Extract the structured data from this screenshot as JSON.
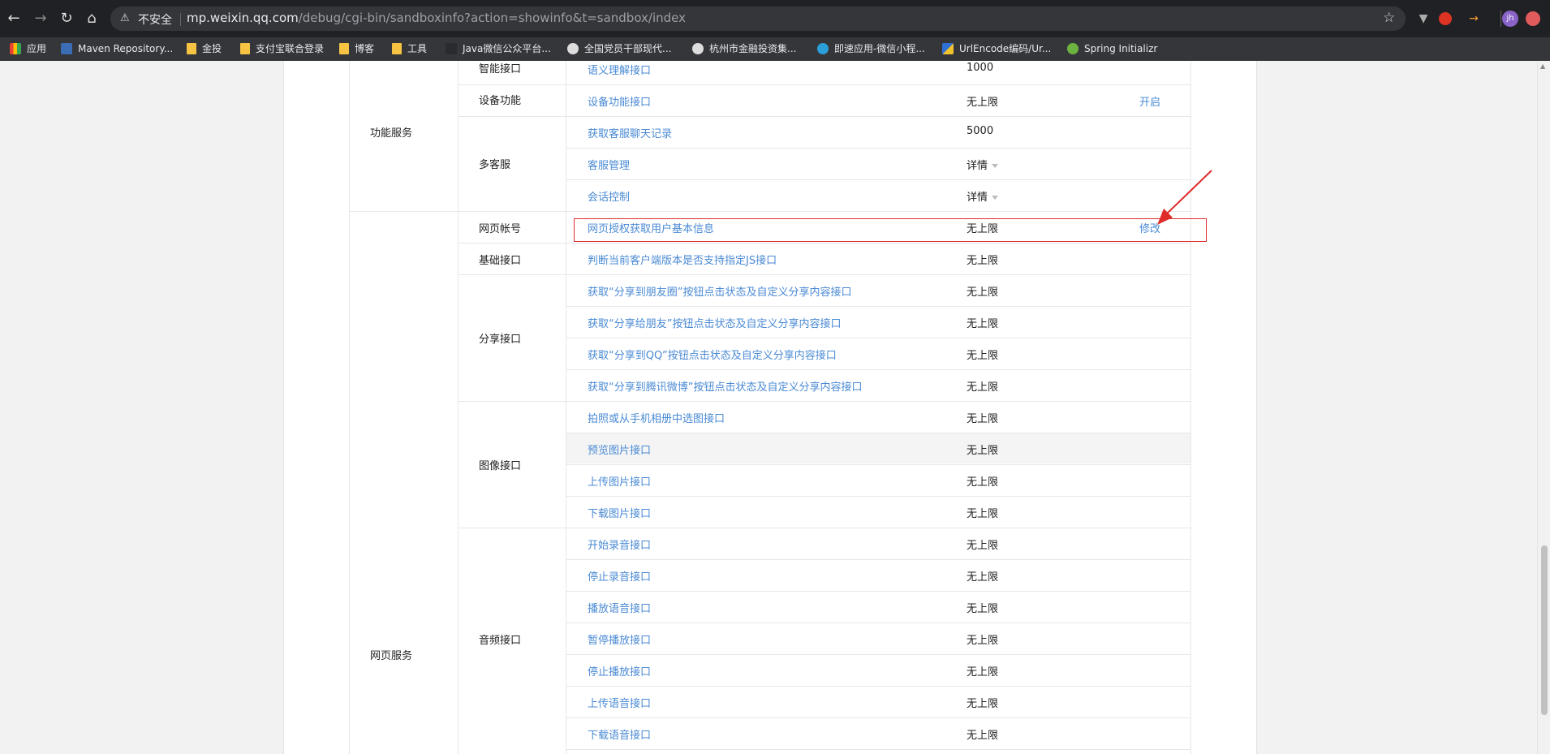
{
  "browser": {
    "insecure_label": "不安全",
    "url_host": "mp.weixin.qq.com",
    "url_path": "/debug/cgi-bin/sandboxinfo?action=showinfo&t=sandbox/index",
    "profile_initials": "jh",
    "bookmarks": [
      {
        "label": "应用",
        "icon": "apps-grid-icon"
      },
      {
        "label": "Maven Repository...",
        "icon": "maven-icon"
      },
      {
        "label": "金投",
        "icon": "folder-icon"
      },
      {
        "label": "支付宝联合登录",
        "icon": "folder-icon"
      },
      {
        "label": "博客",
        "icon": "folder-icon"
      },
      {
        "label": "工具",
        "icon": "folder-icon"
      },
      {
        "label": "Java微信公众平台...",
        "icon": "blank-page-icon"
      },
      {
        "label": "全国党员干部现代...",
        "icon": "globe-icon"
      },
      {
        "label": "杭州市金融投资集...",
        "icon": "globe-icon"
      },
      {
        "label": "即速应用-微信小程...",
        "icon": "app-logo-icon"
      },
      {
        "label": "UrlEncode编码/Ur...",
        "icon": "urlencode-icon"
      },
      {
        "label": "Spring Initializr",
        "icon": "spring-leaf-icon"
      }
    ]
  },
  "table": {
    "sections": [
      {
        "name": "功能服务"
      },
      {
        "name": "网页服务"
      }
    ],
    "groups": [
      {
        "name": "智能接口"
      },
      {
        "name": "设备功能"
      },
      {
        "name": "多客服"
      },
      {
        "name": "网页帐号"
      },
      {
        "name": "基础接口"
      },
      {
        "name": "分享接口"
      },
      {
        "name": "图像接口"
      },
      {
        "name": "音频接口"
      }
    ],
    "rows": [
      {
        "api": "语义理解接口",
        "limit": "1000",
        "action": ""
      },
      {
        "api": "设备功能接口",
        "limit": "无上限",
        "action": "开启"
      },
      {
        "api": "获取客服聊天记录",
        "limit": "5000",
        "action": ""
      },
      {
        "api": "客服管理",
        "limit": "详情",
        "action": ""
      },
      {
        "api": "会话控制",
        "limit": "详情",
        "action": ""
      },
      {
        "api": "网页授权获取用户基本信息",
        "limit": "无上限",
        "action": "修改"
      },
      {
        "api": "判断当前客户端版本是否支持指定JS接口",
        "limit": "无上限",
        "action": ""
      },
      {
        "api": "获取“分享到朋友圈”按钮点击状态及自定义分享内容接口",
        "limit": "无上限",
        "action": ""
      },
      {
        "api": "获取“分享给朋友”按钮点击状态及自定义分享内容接口",
        "limit": "无上限",
        "action": ""
      },
      {
        "api": "获取“分享到QQ”按钮点击状态及自定义分享内容接口",
        "limit": "无上限",
        "action": ""
      },
      {
        "api": "获取“分享到腾讯微博”按钮点击状态及自定义分享内容接口",
        "limit": "无上限",
        "action": ""
      },
      {
        "api": "拍照或从手机相册中选图接口",
        "limit": "无上限",
        "action": ""
      },
      {
        "api": "预览图片接口",
        "limit": "无上限",
        "action": ""
      },
      {
        "api": "上传图片接口",
        "limit": "无上限",
        "action": ""
      },
      {
        "api": "下载图片接口",
        "limit": "无上限",
        "action": ""
      },
      {
        "api": "开始录音接口",
        "limit": "无上限",
        "action": ""
      },
      {
        "api": "停止录音接口",
        "limit": "无上限",
        "action": ""
      },
      {
        "api": "播放语音接口",
        "limit": "无上限",
        "action": ""
      },
      {
        "api": "暂停播放接口",
        "limit": "无上限",
        "action": ""
      },
      {
        "api": "停止播放接口",
        "limit": "无上限",
        "action": ""
      },
      {
        "api": "上传语音接口",
        "limit": "无上限",
        "action": ""
      },
      {
        "api": "下载语音接口",
        "limit": "无上限",
        "action": ""
      }
    ]
  },
  "colors": {
    "link": "#4a8ad4",
    "annotation": "#e02b2b"
  }
}
